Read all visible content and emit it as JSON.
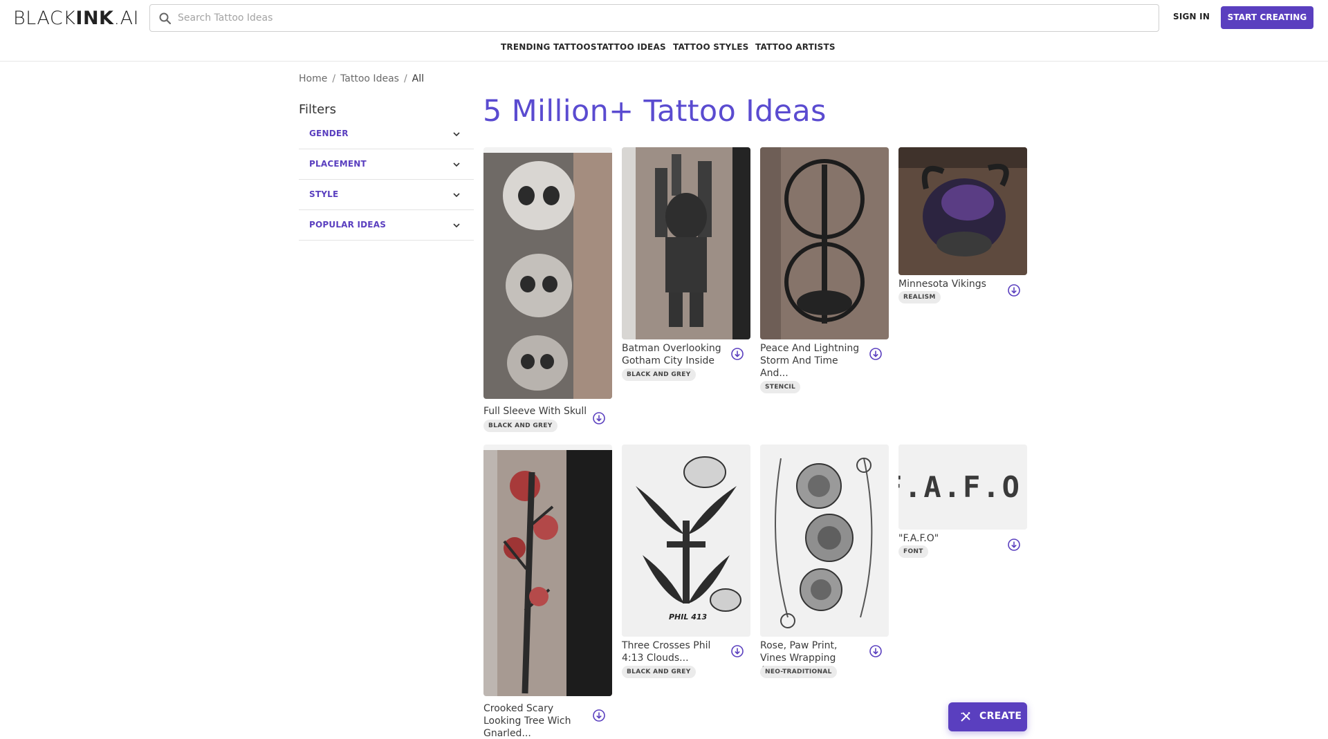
{
  "header": {
    "logo": {
      "part1": "BLACK",
      "part2": "INK",
      "part3": ".AI"
    },
    "search_placeholder": "Search Tattoo Ideas",
    "signin_label": "SIGN IN",
    "start_label": "START CREATING",
    "nav": [
      "TRENDING TATTOOS",
      "TATTOO IDEAS",
      "TATTOO STYLES",
      "TATTOO ARTISTS"
    ]
  },
  "breadcrumb": {
    "items": [
      "Home",
      "Tattoo Ideas",
      "All"
    ],
    "separator": "/"
  },
  "filters": {
    "title": "Filters",
    "items": [
      "GENDER",
      "PLACEMENT",
      "STYLE",
      "POPULAR IDEAS"
    ]
  },
  "main": {
    "title": "5 Million+ Tattoo Ideas",
    "cards": [
      {
        "title": "Full Sleeve With Skull",
        "tag": "BLACK AND GREY"
      },
      {
        "title": "Batman Overlooking Gotham City Inside",
        "tag": "BLACK AND GREY"
      },
      {
        "title": "Peace And Lightning Storm And Time And...",
        "tag": "STENCIL"
      },
      {
        "title": "Minnesota Vikings",
        "tag": "REALISM"
      },
      {
        "title": "Crooked Scary Looking Tree Wich Gnarled...",
        "tag": ""
      },
      {
        "title": "Three Crosses Phil 4:13 Clouds...",
        "tag": "BLACK AND GREY"
      },
      {
        "title": "Rose, Paw Print, Vines Wrapping Around...",
        "tag": "NEO-TRADITIONAL"
      },
      {
        "title": "\"F.A.F.O\"",
        "tag": "FONT"
      }
    ],
    "fafo_art_text": "F.A.F.O.",
    "phil_art_text": "PHIL 413"
  },
  "create_button": {
    "label": "CREATE"
  },
  "colors": {
    "accent": "#5a3fbf",
    "title": "#5a4bd0"
  }
}
